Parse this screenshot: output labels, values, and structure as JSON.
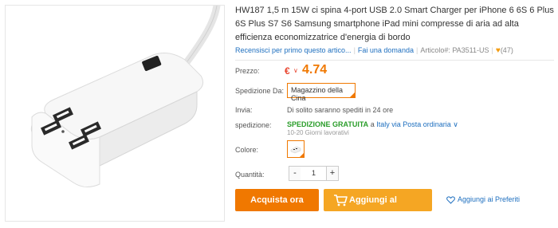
{
  "product": {
    "title": "HW187 1,5 m 15W ci spina 4-port USB 2.0 Smart Charger per iPhone 6 6S 6 Plus 6S Plus S7 S6 Samsung smartphone iPad mini compresse di aria ad alta efficienza economizzatrice d'energia di bordo"
  },
  "meta": {
    "review_link": "Recensisci per primo questo artico...",
    "question_link": "Fai una domanda",
    "article_label": "Articolo#: PA3511-US",
    "likes": "(47)"
  },
  "price": {
    "label": "Prezzo:",
    "currency": "€",
    "value": "4.74"
  },
  "shipping": {
    "from_label": "Spedizione Da:",
    "from_value": "Magazzino della Cina",
    "send_label": "Invia:",
    "send_value": "Di solito saranno spediti in 24 ore",
    "method_label": "spedizione:",
    "free_text": "SPEDIZIONE GRATUITA",
    "to_text": "a",
    "method_link": "Italy via Posta ordinaria",
    "days": "10-20 Giorni lavorativi"
  },
  "color": {
    "label": "Colore:"
  },
  "quantity": {
    "label": "Quantità:",
    "minus": "-",
    "value": "1",
    "plus": "+"
  },
  "actions": {
    "buy": "Acquista ora",
    "cart": "Aggiungi al Carrello",
    "wishlist": "Aggiungi ai Preferiti"
  },
  "colors": {
    "accent_orange": "#f07800",
    "cart_orange": "#f5a623",
    "link_blue": "#1e6fbf",
    "free_green": "#2a9d2a",
    "price_red": "#e8442e"
  }
}
